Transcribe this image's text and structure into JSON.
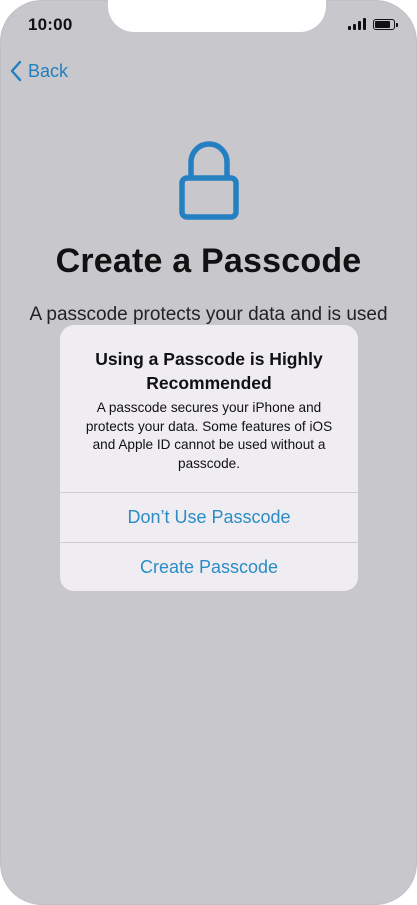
{
  "status_bar": {
    "time": "10:00",
    "icons": [
      "cellular-signal-icon",
      "battery-icon"
    ]
  },
  "nav": {
    "back_label": "Back",
    "back_icon": "chevron-left-icon"
  },
  "page": {
    "icon": "lock-icon",
    "title": "Create a Passcode",
    "subtitle": "A passcode protects your data and is used"
  },
  "alert": {
    "title": "Using a Passcode is Highly Recommended",
    "message": "A passcode secures your iPhone and protects your data. Some features of iOS and Apple ID cannot be used without a passcode.",
    "buttons": [
      {
        "label": "Don’t Use Passcode"
      },
      {
        "label": "Create Passcode"
      }
    ]
  },
  "colors": {
    "accent": "#2a8cc5",
    "background": "#c8c7cc",
    "alert_background": "#efedf1"
  }
}
